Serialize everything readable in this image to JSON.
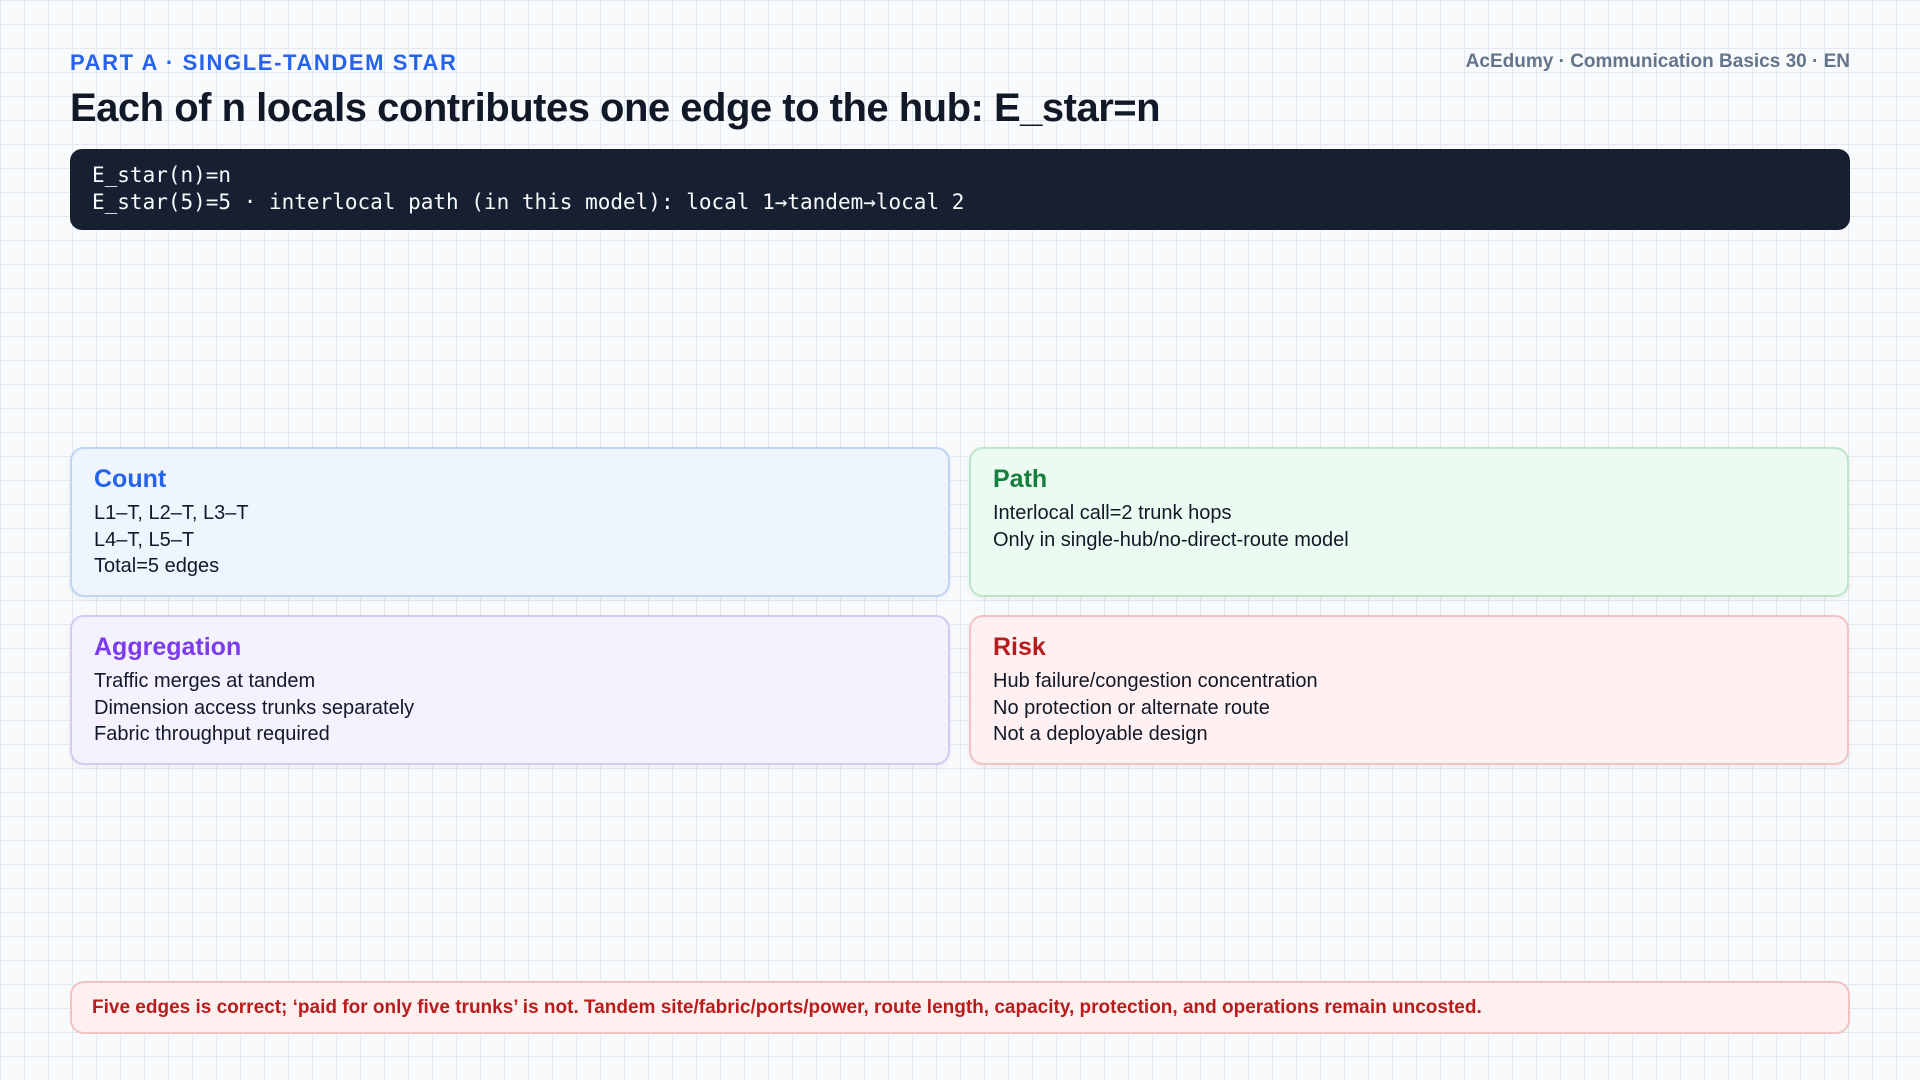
{
  "header": {
    "kicker": "PART A · SINGLE-TANDEM STAR",
    "brand": "AcEdumy · Communication Basics 30 · EN",
    "title": "Each of n locals contributes one edge to the hub: E_star=n"
  },
  "code": {
    "lines": [
      "E_star(n)=n",
      "E_star(5)=5 · interlocal path (in this model): local 1→tandem→local 2"
    ]
  },
  "cards": [
    {
      "title": "Count",
      "lines": [
        "L1–T, L2–T, L3–T",
        "L4–T, L5–T",
        "Total=5 edges"
      ]
    },
    {
      "title": "Path",
      "lines": [
        "Interlocal call=2 trunk hops",
        "Only in single-hub/no-direct-route model"
      ]
    },
    {
      "title": "Aggregation",
      "lines": [
        "Traffic merges at tandem",
        "Dimension access trunks separately",
        "Fabric throughput required"
      ]
    },
    {
      "title": "Risk",
      "lines": [
        "Hub failure/congestion concentration",
        "No protection or alternate route",
        "Not a deployable design"
      ]
    }
  ],
  "warning": "Five edges is correct; ‘paid for only five trunks’ is not. Tandem site/fabric/ports/power, route length, capacity, protection, and operations remain uncosted.",
  "colors": {
    "accent_blue": "#2563eb",
    "accent_green": "#15803d",
    "accent_purple": "#7c3aed",
    "accent_red": "#b91c1c",
    "code_bg": "#172033"
  }
}
